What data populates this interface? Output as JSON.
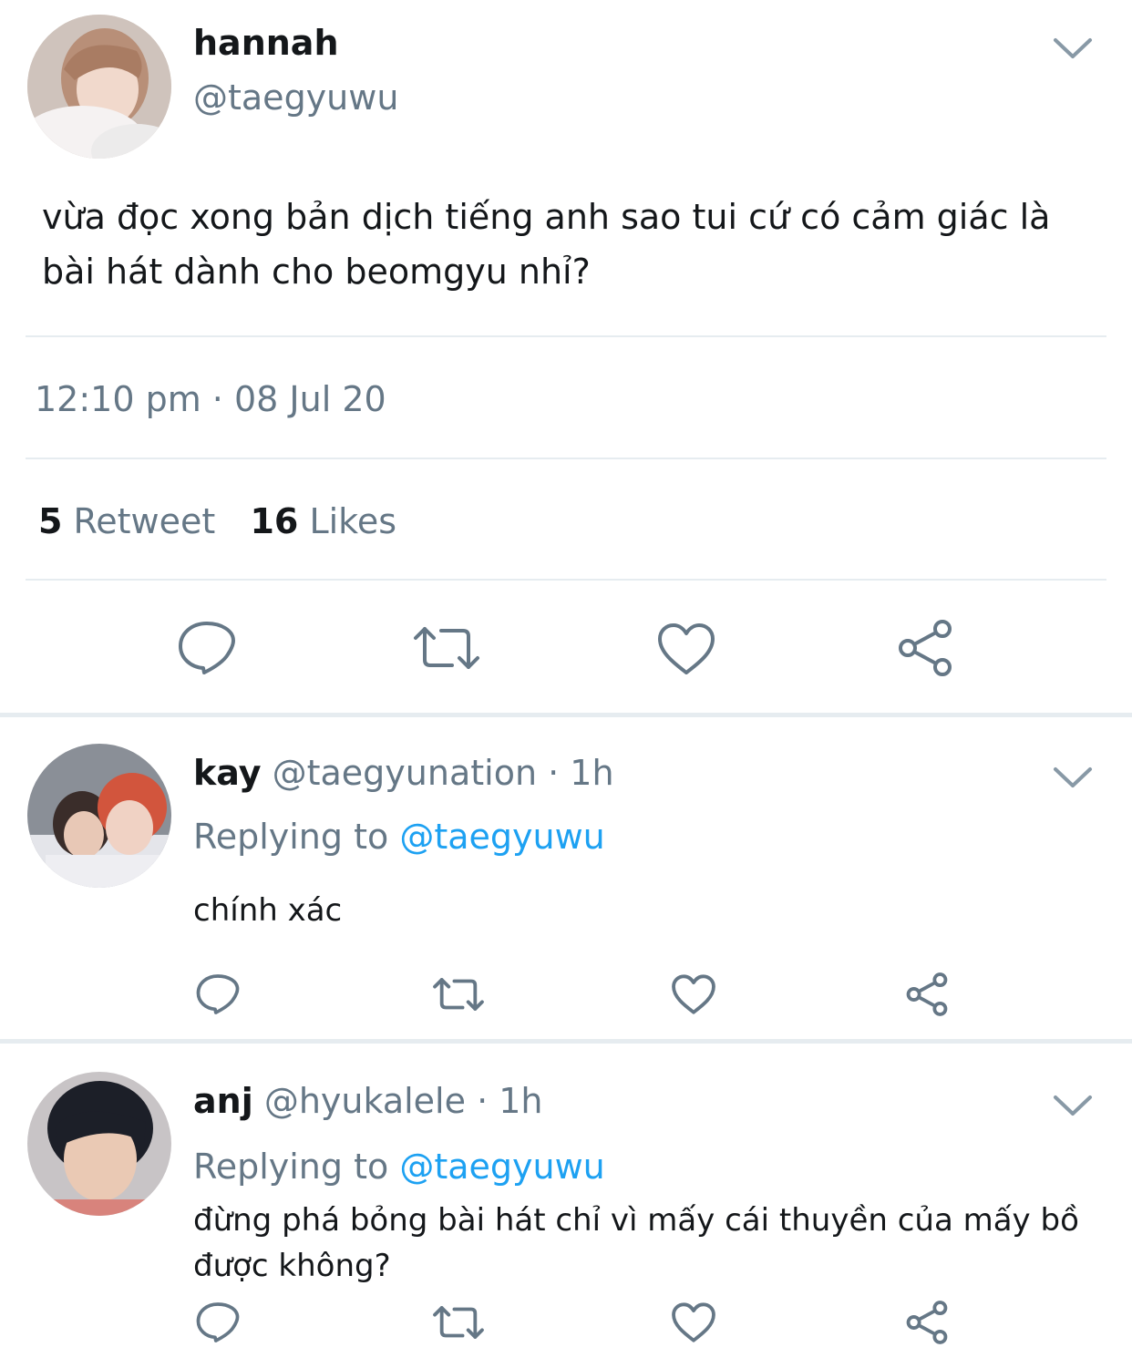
{
  "main_tweet": {
    "display_name": "hannah",
    "handle": "@taegyuwu",
    "text_line1": "vừa đọc xong bản dịch tiếng anh sao tui cứ có cảm giác là",
    "text_line2": "bài hát dành cho beomgyu nhỉ?",
    "timestamp": "12:10 pm · 08 Jul 20",
    "retweet_count": "5",
    "retweet_label": "Retweet",
    "like_count": "16",
    "like_label": "Likes"
  },
  "replies": [
    {
      "display_name": "kay",
      "handle": "@taegyunation",
      "time": "· 1h",
      "replying_prefix": "Replying to",
      "replying_handle": "@taegyuwu",
      "text_line1": "chính xác",
      "text_line2": ""
    },
    {
      "display_name": "anj",
      "handle": "@hyukalele",
      "time": "· 1h",
      "replying_prefix": "Replying to",
      "replying_handle": "@taegyuwu",
      "text_line1": "đừng phá bỏng bài hát chỉ vì mấy cái thuyền của mấy bồ",
      "text_line2": "được không?"
    }
  ],
  "icons": [
    "reply-icon",
    "retweet-icon",
    "like-icon",
    "share-icon",
    "chevron-down-icon"
  ],
  "colors": {
    "text": "#14171a",
    "secondary": "#657786",
    "link": "#1da1f2",
    "divider": "#e6ecf0"
  }
}
